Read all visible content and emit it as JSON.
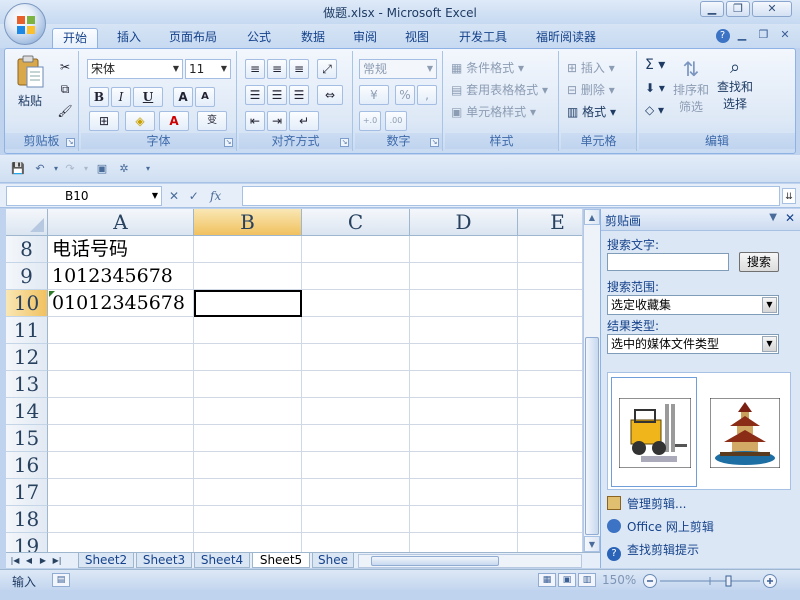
{
  "window": {
    "title": "做题.xlsx - Microsoft Excel",
    "min_icon": "minimize-icon",
    "max_icon": "restore-icon",
    "close_icon": "close-icon"
  },
  "ribbon_tabs": [
    "开始",
    "插入",
    "页面布局",
    "公式",
    "数据",
    "审阅",
    "视图",
    "开发工具",
    "福昕阅读器"
  ],
  "active_tab": "开始",
  "ribbon": {
    "clipboard": {
      "paste": "粘贴",
      "label": "剪贴板"
    },
    "font": {
      "name": "宋体",
      "size": "11",
      "bold": "B",
      "italic": "I",
      "underline": "U",
      "grow": "A",
      "shrink": "A",
      "label": "字体",
      "wen": "wén",
      "zi": "变"
    },
    "alignment": {
      "label": "对齐方式"
    },
    "number": {
      "format": "常规",
      "label": "数字",
      "percent": "%",
      "comma": ",",
      "inc_dec": "+.0 .00",
      "dec_dec": ".00 →.0"
    },
    "styles": {
      "conditional": "条件格式",
      "table": "套用表格格式",
      "cell": "单元格样式",
      "label": "样式"
    },
    "cells": {
      "insert": "插入",
      "delete": "删除",
      "format": "格式",
      "label": "单元格"
    },
    "editing": {
      "sum": "Σ",
      "sort": "排序和",
      "sort2": "筛选",
      "find": "查找和",
      "find2": "选择",
      "label": "编辑"
    }
  },
  "formula_bar": {
    "name_box": "B10",
    "value": "",
    "fx": "fx"
  },
  "grid": {
    "columns": [
      "A",
      "B",
      "C",
      "D",
      "E"
    ],
    "rows": [
      "8",
      "9",
      "10",
      "11",
      "12",
      "13",
      "14",
      "15",
      "16",
      "17",
      "18",
      "19"
    ],
    "cells": {
      "A8": "电话号码",
      "A9": "1012345678",
      "A10": "01012345678"
    }
  },
  "sheet_tabs": [
    "Sheet2",
    "Sheet3",
    "Sheet4",
    "Sheet5",
    "Shee"
  ],
  "active_sheet": "Sheet5",
  "status": {
    "mode": "输入",
    "zoom": "150%"
  },
  "clip_pane": {
    "title": "剪贴画",
    "search_label": "搜索文字:",
    "search_value": "",
    "search_button": "搜索",
    "scope_label": "搜索范围:",
    "scope_value": "选定收藏集",
    "type_label": "结果类型:",
    "type_value": "选中的媒体文件类型",
    "results": [
      "forklift-clipart",
      "pagoda-clipart"
    ],
    "links": [
      "管理剪辑...",
      "Office 网上剪辑",
      "查找剪辑提示"
    ]
  },
  "colors": {
    "ribbon_bg": "#dde8f6",
    "tab_text": "#15428b",
    "selected_header": "#f1c15f"
  }
}
